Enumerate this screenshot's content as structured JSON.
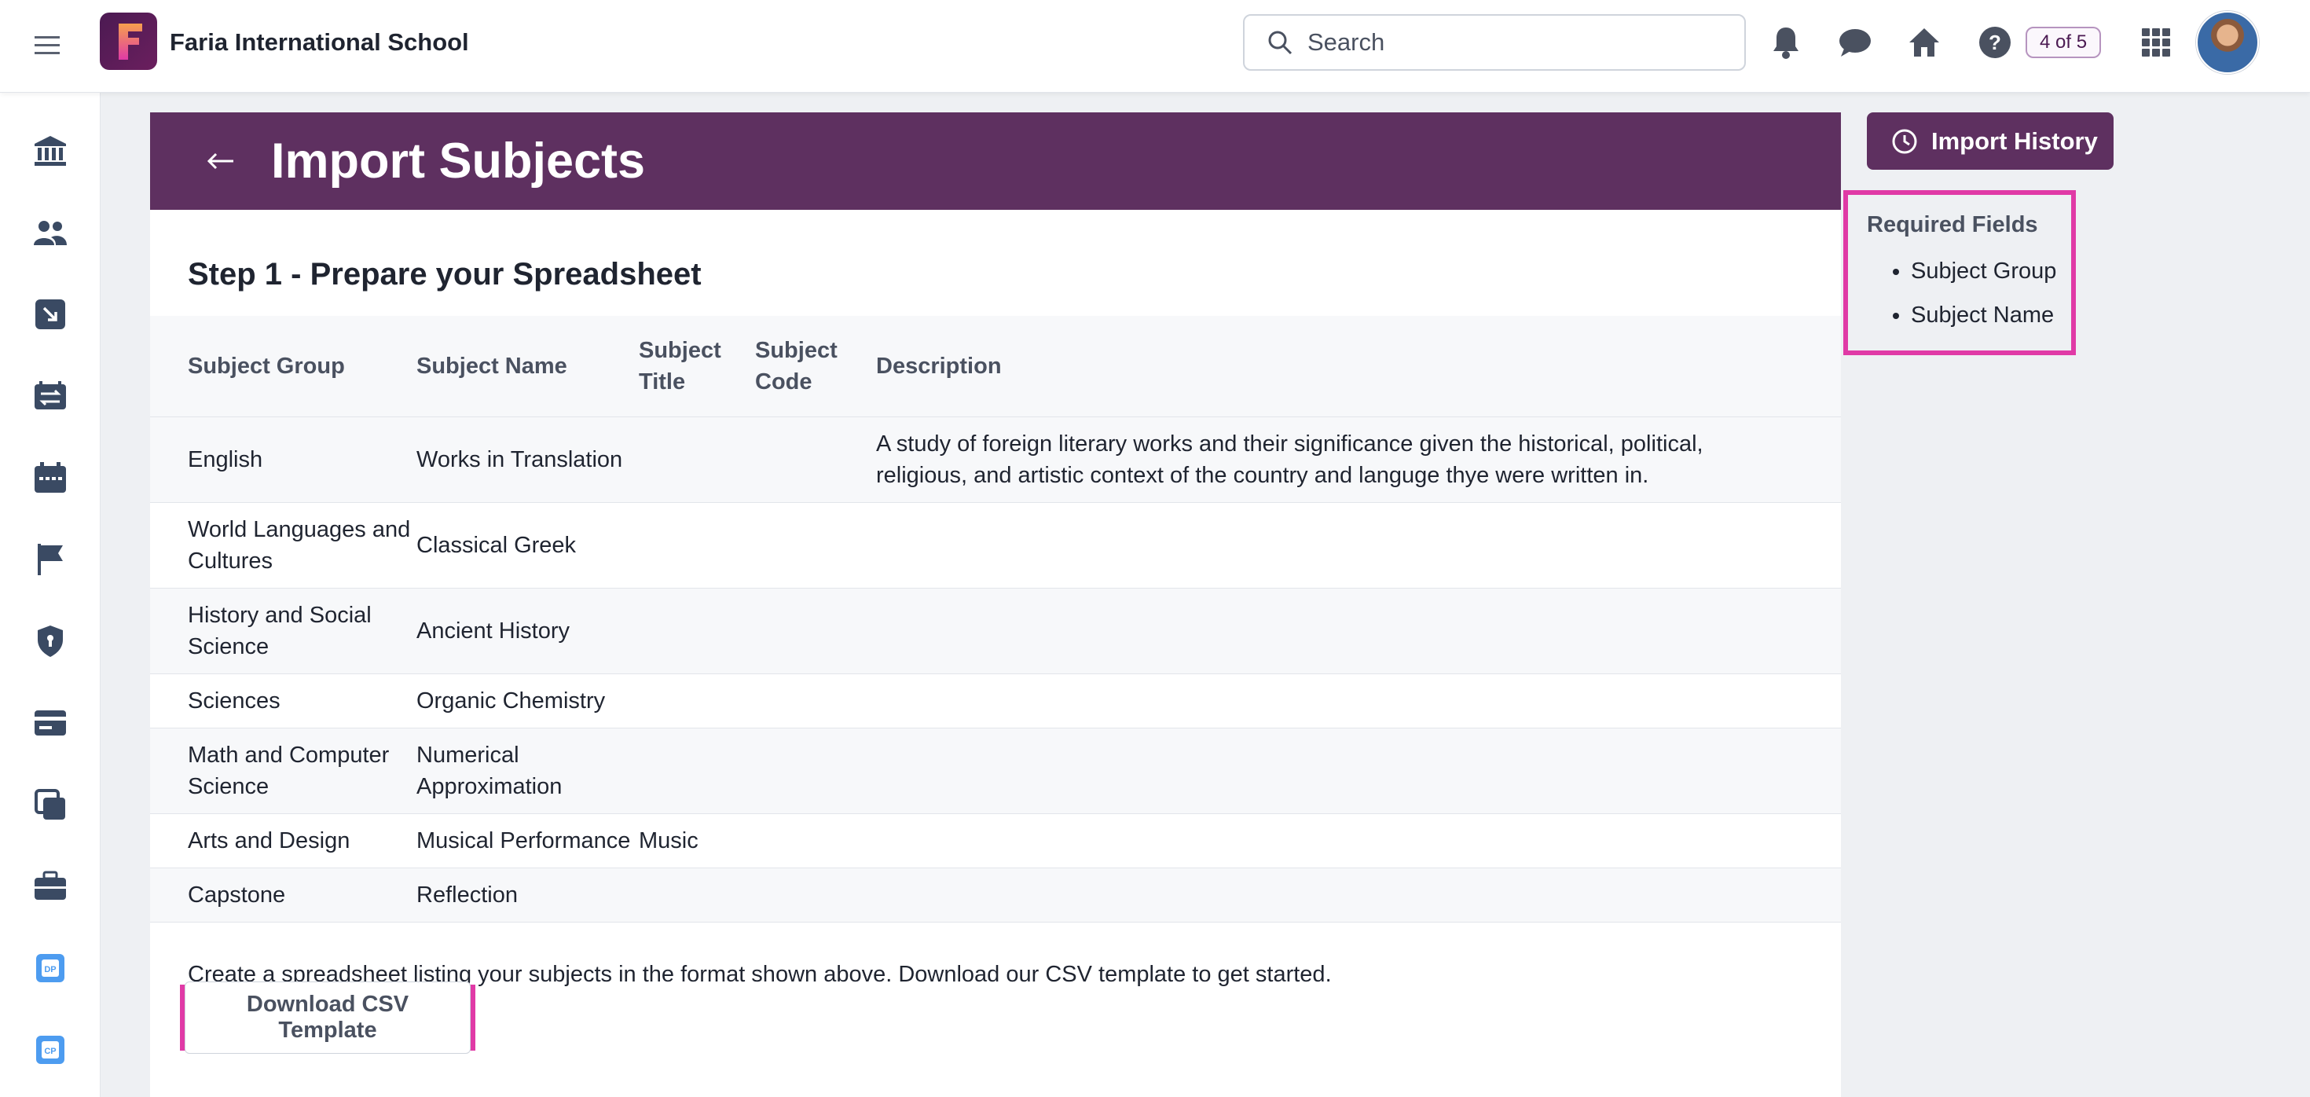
{
  "header": {
    "school_name": "Faria International School",
    "search_placeholder": "Search",
    "pager": "4 of 5"
  },
  "page": {
    "title": "Import Subjects",
    "step_title": "Step 1 - Prepare your Spreadsheet",
    "instructions": "Create a spreadsheet listing your subjects in the format shown above. Download our CSV template to get started.",
    "download_button": "Download CSV Template"
  },
  "table": {
    "headers": [
      "Subject Group",
      "Subject Name",
      "Subject Title",
      "Subject Code",
      "Description"
    ],
    "rows": [
      [
        "English",
        "Works in Translation",
        "",
        "",
        "A study of foreign literary works and their significance given the historical, political, religious, and artistic context of the country and languge thye were written in."
      ],
      [
        "World Languages and Cultures",
        "Classical Greek",
        "",
        "",
        ""
      ],
      [
        "History and Social Science",
        "Ancient History",
        "",
        "",
        ""
      ],
      [
        "Sciences",
        "Organic Chemistry",
        "",
        "",
        ""
      ],
      [
        "Math and Computer Science",
        "Numerical Approximation",
        "",
        "",
        ""
      ],
      [
        "Arts and Design",
        "Musical Performance",
        "Music",
        "",
        ""
      ],
      [
        "Capstone",
        "Reflection",
        "",
        "",
        ""
      ]
    ]
  },
  "side_panel": {
    "import_history_label": "Import History",
    "required_title": "Required Fields",
    "required_items": [
      "Subject Group",
      "Subject Name"
    ]
  },
  "colors": {
    "brand": "#5e3060",
    "highlight": "#e03aa6"
  },
  "icons": {
    "sidebar": [
      "institution-icon",
      "people-icon",
      "import-arrow-icon",
      "transfer-icon",
      "calendar-icon",
      "flag-icon",
      "shield-icon",
      "card-icon",
      "copy-icon",
      "briefcase-icon",
      "dp-app-icon",
      "cp-app-icon"
    ]
  }
}
